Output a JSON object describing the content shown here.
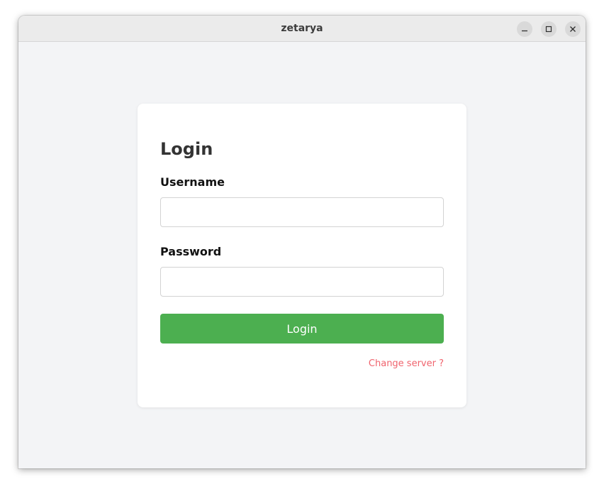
{
  "window": {
    "title": "zetarya",
    "controls": {
      "minimize_icon": "minimize-icon",
      "maximize_icon": "maximize-icon",
      "close_icon": "close-icon"
    }
  },
  "login_form": {
    "heading": "Login",
    "username_label": "Username",
    "username_value": "",
    "password_label": "Password",
    "password_value": "",
    "submit_label": "Login",
    "change_server_link": "Change server ?"
  },
  "colors": {
    "accent_button": "#4caf50",
    "link": "#f0646e",
    "background": "#f3f4f6",
    "card": "#ffffff"
  }
}
